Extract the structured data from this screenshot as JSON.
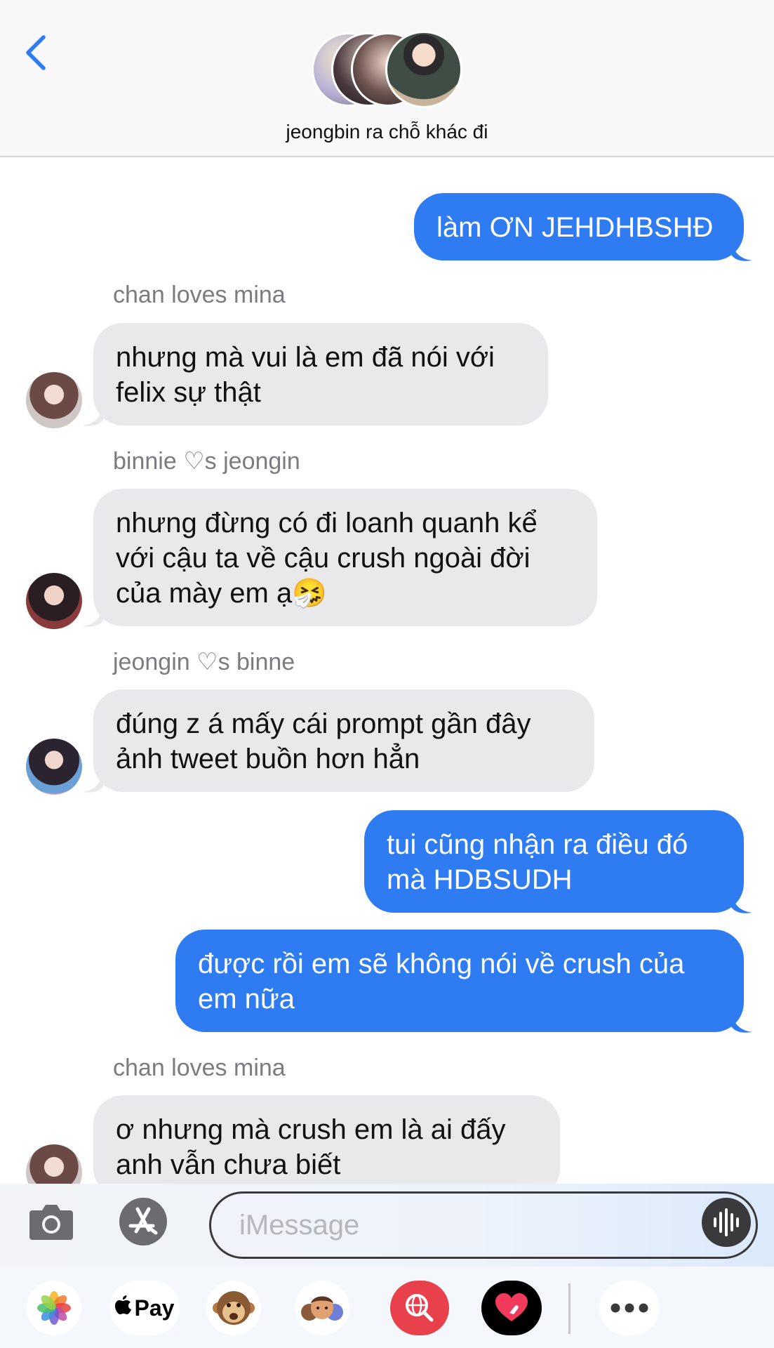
{
  "header": {
    "back_icon": "chevron-left-icon",
    "group_name": "jeongbin ra chỗ khác đi",
    "accent_color": "#2f7bf1"
  },
  "messages": [
    {
      "direction": "outgoing",
      "lines": [
        "làm ƠN JEHDHBSHĐ"
      ]
    },
    {
      "direction": "incoming",
      "sender": "chan loves mina",
      "lines": [
        "nhưng mà vui là em đã nói với",
        "felix sự thật"
      ]
    },
    {
      "direction": "incoming",
      "sender": "binnie ♡s jeongin",
      "lines": [
        "nhưng đừng có đi loanh quanh kể",
        "với cậu ta về cậu crush ngoài đời",
        "của mày em ạ🤧"
      ]
    },
    {
      "direction": "incoming",
      "sender": "jeongin ♡s binne",
      "lines": [
        "đúng z á mấy cái prompt gần đây",
        "ảnh tweet buồn hơn hẳn"
      ]
    },
    {
      "direction": "outgoing",
      "lines": [
        "tui cũng nhận ra điều đó",
        "mà HDBSUDH"
      ]
    },
    {
      "direction": "outgoing",
      "lines": [
        "được rồi em sẽ không nói về crush của",
        "em nữa"
      ]
    },
    {
      "direction": "incoming",
      "sender": "chan loves mina",
      "lines": [
        "ơ nhưng mà crush em là ai đấy",
        "anh vẫn chưa biết"
      ]
    }
  ],
  "composer": {
    "camera_icon": "camera-icon",
    "apps_icon": "app-store-icon",
    "placeholder": "iMessage",
    "value": "",
    "voice_icon": "audio-waveform-icon"
  },
  "app_drawer": {
    "items": [
      {
        "icon": "photos-icon"
      },
      {
        "icon": "apple-pay-icon",
        "label": "Pay"
      },
      {
        "icon": "monkey-memoji-icon"
      },
      {
        "icon": "memoji-stickers-icon"
      },
      {
        "icon": "web-image-search-icon"
      },
      {
        "icon": "digital-touch-heart-icon"
      },
      {
        "icon": "more-icon"
      }
    ]
  },
  "colors": {
    "outgoing_bubble": "#2f7bf1",
    "incoming_bubble": "#e9e9eb",
    "sender_name": "#7b7b80"
  }
}
